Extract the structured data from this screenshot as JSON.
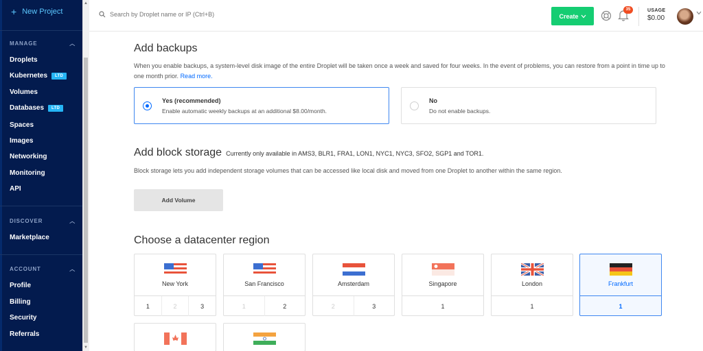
{
  "sidebar": {
    "new_project": "New Project",
    "sections": [
      {
        "title": "MANAGE",
        "items": [
          {
            "label": "Droplets"
          },
          {
            "label": "Kubernetes",
            "badge": "LTD"
          },
          {
            "label": "Volumes"
          },
          {
            "label": "Databases",
            "badge": "LTD"
          },
          {
            "label": "Spaces"
          },
          {
            "label": "Images"
          },
          {
            "label": "Networking"
          },
          {
            "label": "Monitoring"
          },
          {
            "label": "API"
          }
        ]
      },
      {
        "title": "DISCOVER",
        "items": [
          {
            "label": "Marketplace"
          }
        ]
      },
      {
        "title": "ACCOUNT",
        "items": [
          {
            "label": "Profile"
          },
          {
            "label": "Billing"
          },
          {
            "label": "Security"
          },
          {
            "label": "Referrals"
          }
        ]
      }
    ]
  },
  "topbar": {
    "search_placeholder": "Search by Droplet name or IP (Ctrl+B)",
    "create_label": "Create",
    "notification_count": "35",
    "usage_label": "USAGE",
    "usage_value": "$0.00"
  },
  "backups": {
    "title": "Add backups",
    "description": "When you enable backups, a system-level disk image of the entire Droplet will be taken once a week and saved for four weeks. In the event of problems, you can restore from a point in time up to one month prior.",
    "read_more": "Read more.",
    "options": [
      {
        "title": "Yes (recommended)",
        "desc": "Enable automatic weekly backups at an additional $8.00/month.",
        "selected": true
      },
      {
        "title": "No",
        "desc": "Do not enable backups.",
        "selected": false
      }
    ]
  },
  "block_storage": {
    "title": "Add block storage",
    "subtitle": "Currently only available in AMS3, BLR1, FRA1, LON1, NYC1, NYC3, SFO2, SGP1 and TOR1.",
    "description": "Block storage lets you add independent storage volumes that can be accessed like local disk and moved from one Droplet to another within the same region.",
    "button": "Add Volume"
  },
  "datacenter": {
    "title": "Choose a datacenter region",
    "regions": [
      {
        "name": "New York",
        "flag": "us-flag-icon",
        "nums": [
          [
            "1",
            false
          ],
          [
            "2",
            true
          ],
          [
            "3",
            false
          ]
        ]
      },
      {
        "name": "San Francisco",
        "flag": "us-flag-icon",
        "nums": [
          [
            "1",
            true
          ],
          [
            "2",
            false
          ]
        ]
      },
      {
        "name": "Amsterdam",
        "flag": "nl-flag-icon",
        "nums": [
          [
            "2",
            true
          ],
          [
            "3",
            false
          ]
        ]
      },
      {
        "name": "Singapore",
        "flag": "sg-flag-icon",
        "nums": [
          [
            "1",
            false
          ]
        ]
      },
      {
        "name": "London",
        "flag": "uk-flag-icon",
        "nums": [
          [
            "1",
            false
          ]
        ]
      },
      {
        "name": "Frankfurt",
        "flag": "de-flag-icon",
        "nums": [
          [
            "1",
            false
          ]
        ],
        "selected": true
      },
      {
        "name": "",
        "flag": "ca-flag-icon",
        "nums": []
      },
      {
        "name": "",
        "flag": "in-flag-icon",
        "nums": []
      }
    ]
  },
  "colors": {
    "sidebar_bg": "#031b4e",
    "accent": "#0069ff",
    "create_green": "#15cd72",
    "badge": "#25b5f5"
  }
}
